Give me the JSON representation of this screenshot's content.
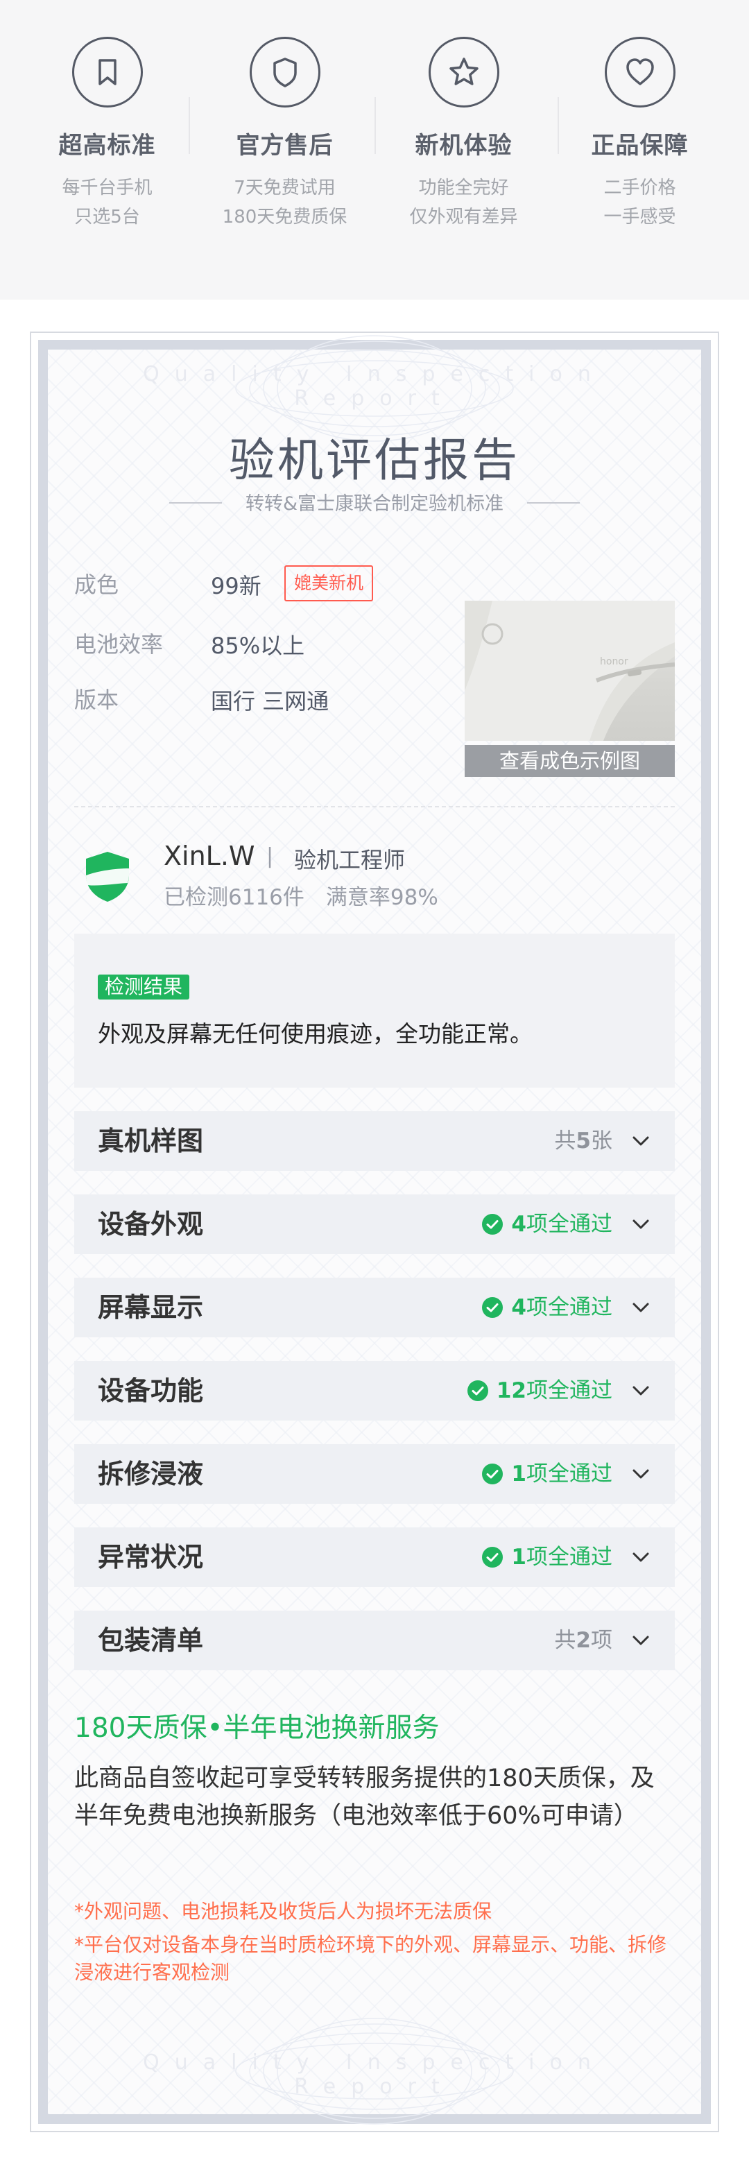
{
  "features": [
    {
      "icon": "bookmark-icon",
      "title": "超高标准",
      "desc1": "每千台手机",
      "desc2": "只选5台"
    },
    {
      "icon": "shield-icon",
      "title": "官方售后",
      "desc1": "7天免费试用",
      "desc2": "180天免费质保"
    },
    {
      "icon": "star-icon",
      "title": "新机体验",
      "desc1": "功能全完好",
      "desc2": "仅外观有差异"
    },
    {
      "icon": "heart-icon",
      "title": "正品保障",
      "desc1": "二手价格",
      "desc2": "一手感受"
    }
  ],
  "report": {
    "watermark": "Quality Inspection Report",
    "title": "验机评估报告",
    "subtitle": "转转&富士康联合制定验机标准",
    "specs": [
      {
        "label": "成色",
        "value": "99新"
      },
      {
        "label": "电池效率",
        "value": "85%以上"
      },
      {
        "label": "版本",
        "value": "国行 三网通"
      }
    ],
    "badge": "媲美新机",
    "image_caption": "查看成色示例图"
  },
  "engineer": {
    "name": "XinL.W",
    "separator": "|",
    "role": "验机工程师",
    "stats": "已检测6116件　满意率98%"
  },
  "result": {
    "tag": "检测结果",
    "text": "外观及屏幕无任何使用痕迹，全功能正常。"
  },
  "sections": [
    {
      "label": "真机样图",
      "prefix": "共",
      "count": "5",
      "suffix": "张",
      "status": "gray"
    },
    {
      "label": "设备外观",
      "prefix": "",
      "count": "4",
      "suffix": "项全通过",
      "status": "green"
    },
    {
      "label": "屏幕显示",
      "prefix": "",
      "count": "4",
      "suffix": "项全通过",
      "status": "green"
    },
    {
      "label": "设备功能",
      "prefix": "",
      "count": "12",
      "suffix": "项全通过",
      "status": "green"
    },
    {
      "label": "拆修浸液",
      "prefix": "",
      "count": "1",
      "suffix": "项全通过",
      "status": "green"
    },
    {
      "label": "异常状况",
      "prefix": "",
      "count": "1",
      "suffix": "项全通过",
      "status": "green"
    },
    {
      "label": "包装清单",
      "prefix": "共",
      "count": "2",
      "suffix": "项",
      "status": "gray"
    }
  ],
  "warranty": {
    "title": "180天质保•半年电池换新服务",
    "text": "此商品自签收起可享受转转服务提供的180天质保，及半年免费电池换新服务（电池效率低于60%可申请）",
    "note1": "*外观问题、电池损耗及收货后人为损坏无法质保",
    "note2": "*平台仅对设备本身在当时质检环境下的外观、屏幕显示、功能、拆修浸液进行客观检测"
  },
  "colors": {
    "accent_green": "#20b55e",
    "warning_red": "#ff5b4f",
    "note_orange": "#ff6f4d"
  }
}
